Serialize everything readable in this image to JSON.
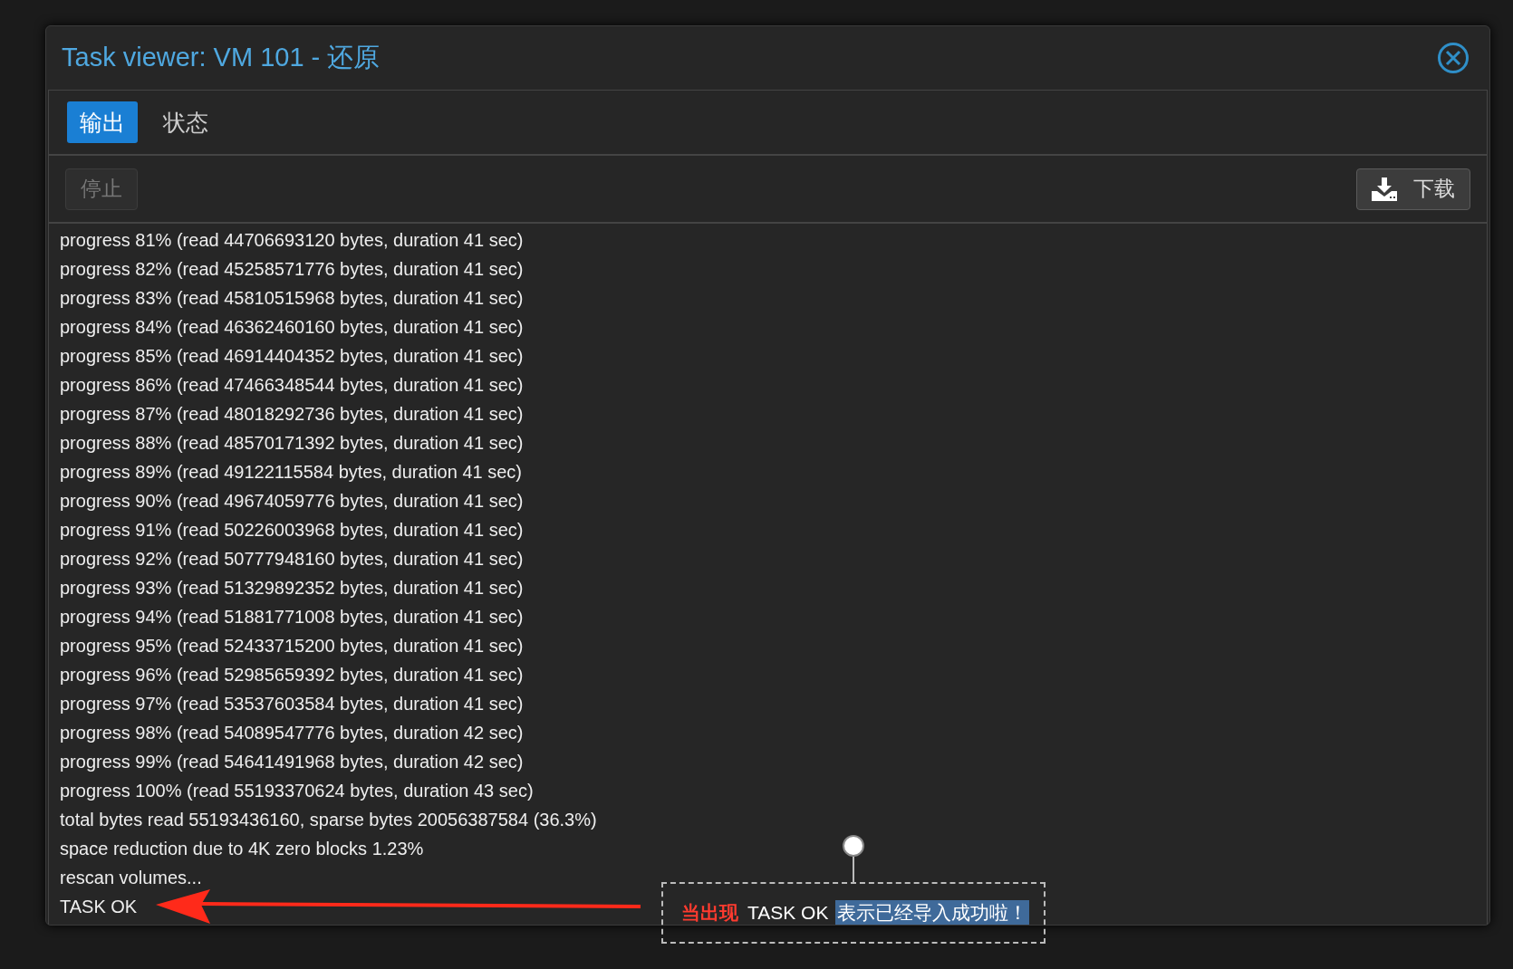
{
  "window": {
    "title": "Task viewer: VM 101 - 还原"
  },
  "tabs": [
    {
      "label": "输出",
      "selected": true
    },
    {
      "label": "状态",
      "selected": false
    }
  ],
  "toolbar": {
    "stop": {
      "label": "停止",
      "disabled": true
    },
    "download": {
      "label": "下载"
    }
  },
  "log": [
    "progress 81% (read 44706693120 bytes, duration 41 sec)",
    "progress 82% (read 45258571776 bytes, duration 41 sec)",
    "progress 83% (read 45810515968 bytes, duration 41 sec)",
    "progress 84% (read 46362460160 bytes, duration 41 sec)",
    "progress 85% (read 46914404352 bytes, duration 41 sec)",
    "progress 86% (read 47466348544 bytes, duration 41 sec)",
    "progress 87% (read 48018292736 bytes, duration 41 sec)",
    "progress 88% (read 48570171392 bytes, duration 41 sec)",
    "progress 89% (read 49122115584 bytes, duration 41 sec)",
    "progress 90% (read 49674059776 bytes, duration 41 sec)",
    "progress 91% (read 50226003968 bytes, duration 41 sec)",
    "progress 92% (read 50777948160 bytes, duration 41 sec)",
    "progress 93% (read 51329892352 bytes, duration 41 sec)",
    "progress 94% (read 51881771008 bytes, duration 41 sec)",
    "progress 95% (read 52433715200 bytes, duration 41 sec)",
    "progress 96% (read 52985659392 bytes, duration 41 sec)",
    "progress 97% (read 53537603584 bytes, duration 41 sec)",
    "progress 98% (read 54089547776 bytes, duration 42 sec)",
    "progress 99% (read 54641491968 bytes, duration 42 sec)",
    "progress 100% (read 55193370624 bytes, duration 43 sec)",
    "total bytes read 55193436160, sparse bytes 20056387584 (36.3%)",
    "space reduction due to 4K zero blocks 1.23%",
    "rescan volumes...",
    "TASK OK"
  ],
  "annotation": {
    "parts": [
      {
        "kind": "emphasis",
        "text": "当出现"
      },
      {
        "kind": "plain",
        "text": "TASK OK"
      },
      {
        "kind": "highlight",
        "text": "表示已经导入成功啦！"
      }
    ]
  }
}
